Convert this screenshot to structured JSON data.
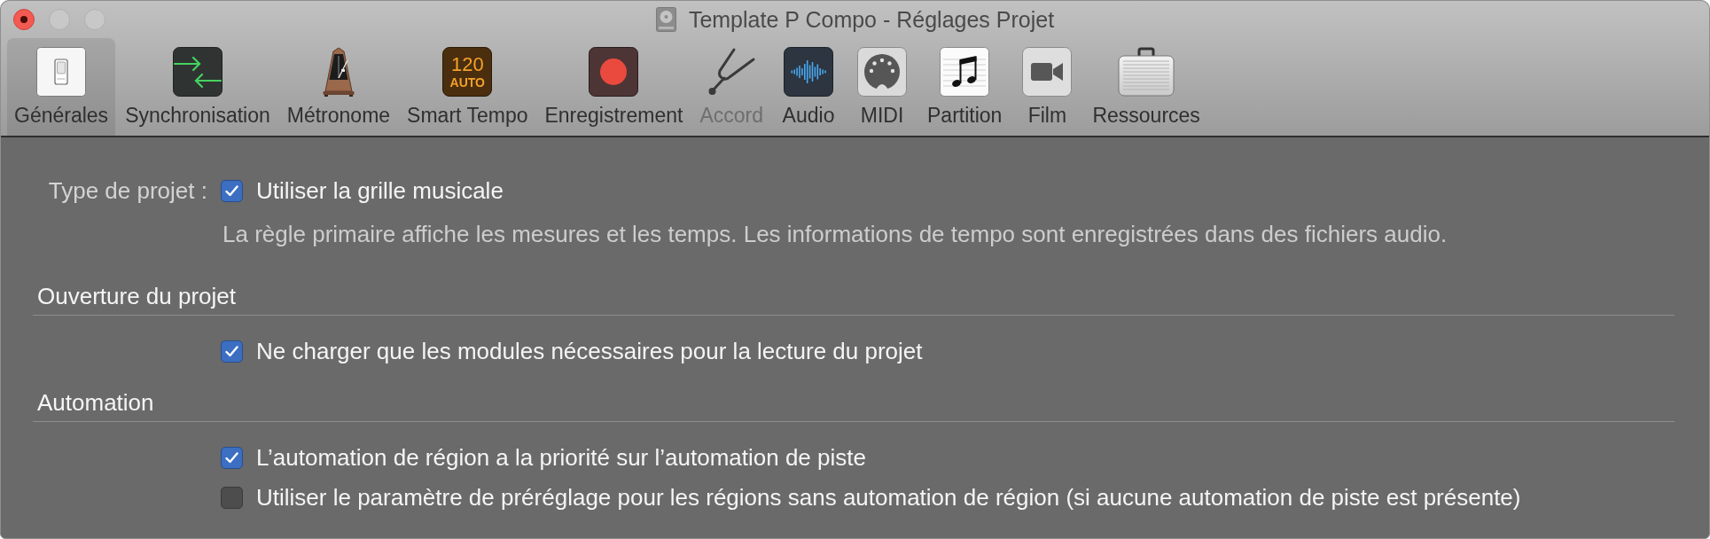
{
  "window": {
    "title": "Template P Compo - Réglages Projet",
    "controls": [
      {
        "kind": "close",
        "disabled": false,
        "edited": true
      },
      {
        "kind": "minimize",
        "disabled": true
      },
      {
        "kind": "zoom",
        "disabled": true
      }
    ]
  },
  "toolbar": [
    {
      "kind": "switch",
      "label": "Générales",
      "selected": true,
      "disabled": false
    },
    {
      "kind": "sync",
      "label": "Synchronisation",
      "selected": false,
      "disabled": false
    },
    {
      "kind": "metronome",
      "label": "Métronome",
      "selected": false,
      "disabled": false
    },
    {
      "kind": "tempo",
      "label": "Smart Tempo",
      "display": [
        "120",
        "AUTO"
      ],
      "selected": false,
      "disabled": false
    },
    {
      "kind": "record",
      "label": "Enregistrement",
      "selected": false,
      "disabled": false
    },
    {
      "kind": "tuning-fork",
      "label": "Accord",
      "selected": false,
      "disabled": true
    },
    {
      "kind": "audio",
      "label": "Audio",
      "selected": false,
      "disabled": false
    },
    {
      "kind": "midi",
      "label": "MIDI",
      "selected": false,
      "disabled": false
    },
    {
      "kind": "score",
      "label": "Partition",
      "selected": false,
      "disabled": false
    },
    {
      "kind": "film",
      "label": "Film",
      "selected": false,
      "disabled": false
    },
    {
      "kind": "briefcase",
      "label": "Ressources",
      "selected": false,
      "disabled": false
    }
  ],
  "project_type": {
    "label": "Type de projet :",
    "option": {
      "label": "Utiliser la grille musicale",
      "checked": true
    },
    "description": "La règle primaire affiche les mesures et les temps. Les informations de tempo sont enregistrées dans des fichiers audio."
  },
  "sections": [
    {
      "heading": "Ouverture du projet",
      "options": [
        {
          "label": "Ne charger que les modules nécessaires pour la lecture du projet",
          "checked": true
        }
      ]
    },
    {
      "heading": "Automation",
      "options": [
        {
          "label": "L’automation de région a la priorité sur l’automation de piste",
          "checked": true
        },
        {
          "label": "Utiliser le paramètre de préréglage pour les régions sans automation de région (si aucune automation de piste est présente)",
          "checked": false
        }
      ]
    }
  ]
}
